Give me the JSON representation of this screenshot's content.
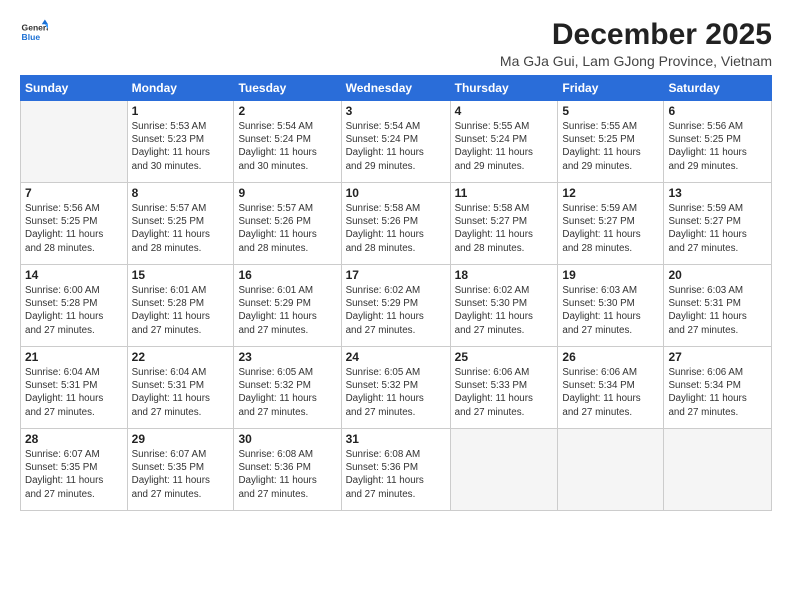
{
  "logo": {
    "line1": "General",
    "line2": "Blue"
  },
  "title": "December 2025",
  "subtitle": "Ma GJa Gui, Lam GJong Province, Vietnam",
  "days_header": [
    "Sunday",
    "Monday",
    "Tuesday",
    "Wednesday",
    "Thursday",
    "Friday",
    "Saturday"
  ],
  "weeks": [
    [
      {
        "day": "",
        "info": ""
      },
      {
        "day": "1",
        "info": "Sunrise: 5:53 AM\nSunset: 5:23 PM\nDaylight: 11 hours\nand 30 minutes."
      },
      {
        "day": "2",
        "info": "Sunrise: 5:54 AM\nSunset: 5:24 PM\nDaylight: 11 hours\nand 30 minutes."
      },
      {
        "day": "3",
        "info": "Sunrise: 5:54 AM\nSunset: 5:24 PM\nDaylight: 11 hours\nand 29 minutes."
      },
      {
        "day": "4",
        "info": "Sunrise: 5:55 AM\nSunset: 5:24 PM\nDaylight: 11 hours\nand 29 minutes."
      },
      {
        "day": "5",
        "info": "Sunrise: 5:55 AM\nSunset: 5:25 PM\nDaylight: 11 hours\nand 29 minutes."
      },
      {
        "day": "6",
        "info": "Sunrise: 5:56 AM\nSunset: 5:25 PM\nDaylight: 11 hours\nand 29 minutes."
      }
    ],
    [
      {
        "day": "7",
        "info": "Sunrise: 5:56 AM\nSunset: 5:25 PM\nDaylight: 11 hours\nand 28 minutes."
      },
      {
        "day": "8",
        "info": "Sunrise: 5:57 AM\nSunset: 5:25 PM\nDaylight: 11 hours\nand 28 minutes."
      },
      {
        "day": "9",
        "info": "Sunrise: 5:57 AM\nSunset: 5:26 PM\nDaylight: 11 hours\nand 28 minutes."
      },
      {
        "day": "10",
        "info": "Sunrise: 5:58 AM\nSunset: 5:26 PM\nDaylight: 11 hours\nand 28 minutes."
      },
      {
        "day": "11",
        "info": "Sunrise: 5:58 AM\nSunset: 5:27 PM\nDaylight: 11 hours\nand 28 minutes."
      },
      {
        "day": "12",
        "info": "Sunrise: 5:59 AM\nSunset: 5:27 PM\nDaylight: 11 hours\nand 28 minutes."
      },
      {
        "day": "13",
        "info": "Sunrise: 5:59 AM\nSunset: 5:27 PM\nDaylight: 11 hours\nand 27 minutes."
      }
    ],
    [
      {
        "day": "14",
        "info": "Sunrise: 6:00 AM\nSunset: 5:28 PM\nDaylight: 11 hours\nand 27 minutes."
      },
      {
        "day": "15",
        "info": "Sunrise: 6:01 AM\nSunset: 5:28 PM\nDaylight: 11 hours\nand 27 minutes."
      },
      {
        "day": "16",
        "info": "Sunrise: 6:01 AM\nSunset: 5:29 PM\nDaylight: 11 hours\nand 27 minutes."
      },
      {
        "day": "17",
        "info": "Sunrise: 6:02 AM\nSunset: 5:29 PM\nDaylight: 11 hours\nand 27 minutes."
      },
      {
        "day": "18",
        "info": "Sunrise: 6:02 AM\nSunset: 5:30 PM\nDaylight: 11 hours\nand 27 minutes."
      },
      {
        "day": "19",
        "info": "Sunrise: 6:03 AM\nSunset: 5:30 PM\nDaylight: 11 hours\nand 27 minutes."
      },
      {
        "day": "20",
        "info": "Sunrise: 6:03 AM\nSunset: 5:31 PM\nDaylight: 11 hours\nand 27 minutes."
      }
    ],
    [
      {
        "day": "21",
        "info": "Sunrise: 6:04 AM\nSunset: 5:31 PM\nDaylight: 11 hours\nand 27 minutes."
      },
      {
        "day": "22",
        "info": "Sunrise: 6:04 AM\nSunset: 5:31 PM\nDaylight: 11 hours\nand 27 minutes."
      },
      {
        "day": "23",
        "info": "Sunrise: 6:05 AM\nSunset: 5:32 PM\nDaylight: 11 hours\nand 27 minutes."
      },
      {
        "day": "24",
        "info": "Sunrise: 6:05 AM\nSunset: 5:32 PM\nDaylight: 11 hours\nand 27 minutes."
      },
      {
        "day": "25",
        "info": "Sunrise: 6:06 AM\nSunset: 5:33 PM\nDaylight: 11 hours\nand 27 minutes."
      },
      {
        "day": "26",
        "info": "Sunrise: 6:06 AM\nSunset: 5:34 PM\nDaylight: 11 hours\nand 27 minutes."
      },
      {
        "day": "27",
        "info": "Sunrise: 6:06 AM\nSunset: 5:34 PM\nDaylight: 11 hours\nand 27 minutes."
      }
    ],
    [
      {
        "day": "28",
        "info": "Sunrise: 6:07 AM\nSunset: 5:35 PM\nDaylight: 11 hours\nand 27 minutes."
      },
      {
        "day": "29",
        "info": "Sunrise: 6:07 AM\nSunset: 5:35 PM\nDaylight: 11 hours\nand 27 minutes."
      },
      {
        "day": "30",
        "info": "Sunrise: 6:08 AM\nSunset: 5:36 PM\nDaylight: 11 hours\nand 27 minutes."
      },
      {
        "day": "31",
        "info": "Sunrise: 6:08 AM\nSunset: 5:36 PM\nDaylight: 11 hours\nand 27 minutes."
      },
      {
        "day": "",
        "info": ""
      },
      {
        "day": "",
        "info": ""
      },
      {
        "day": "",
        "info": ""
      }
    ]
  ]
}
